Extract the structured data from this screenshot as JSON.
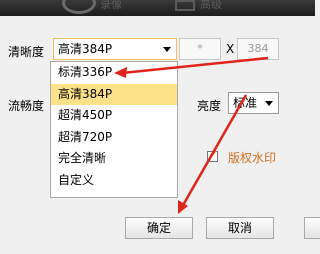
{
  "topbar": {
    "tab1": "录像",
    "tab2": "高级"
  },
  "resolution": {
    "label": "清晰度",
    "selected": "高清384P",
    "width_placeholder": "*",
    "separator": "X",
    "height_value": "384",
    "options": [
      "标清336P",
      "高清384P",
      "超清450P",
      "超清720P",
      "完全清晰",
      "自定义"
    ],
    "highlighted_option": "高清384P"
  },
  "fluency": {
    "label": "流畅度"
  },
  "brightness": {
    "label": "亮度",
    "selected": "标准"
  },
  "watermark": {
    "label": "版权水印",
    "checked": true
  },
  "buttons": {
    "ok": "确定",
    "cancel": "取消"
  },
  "colors": {
    "highlight": "#fde28a",
    "annotation_arrow": "#e0241c",
    "watermark_text": "#d07020"
  }
}
